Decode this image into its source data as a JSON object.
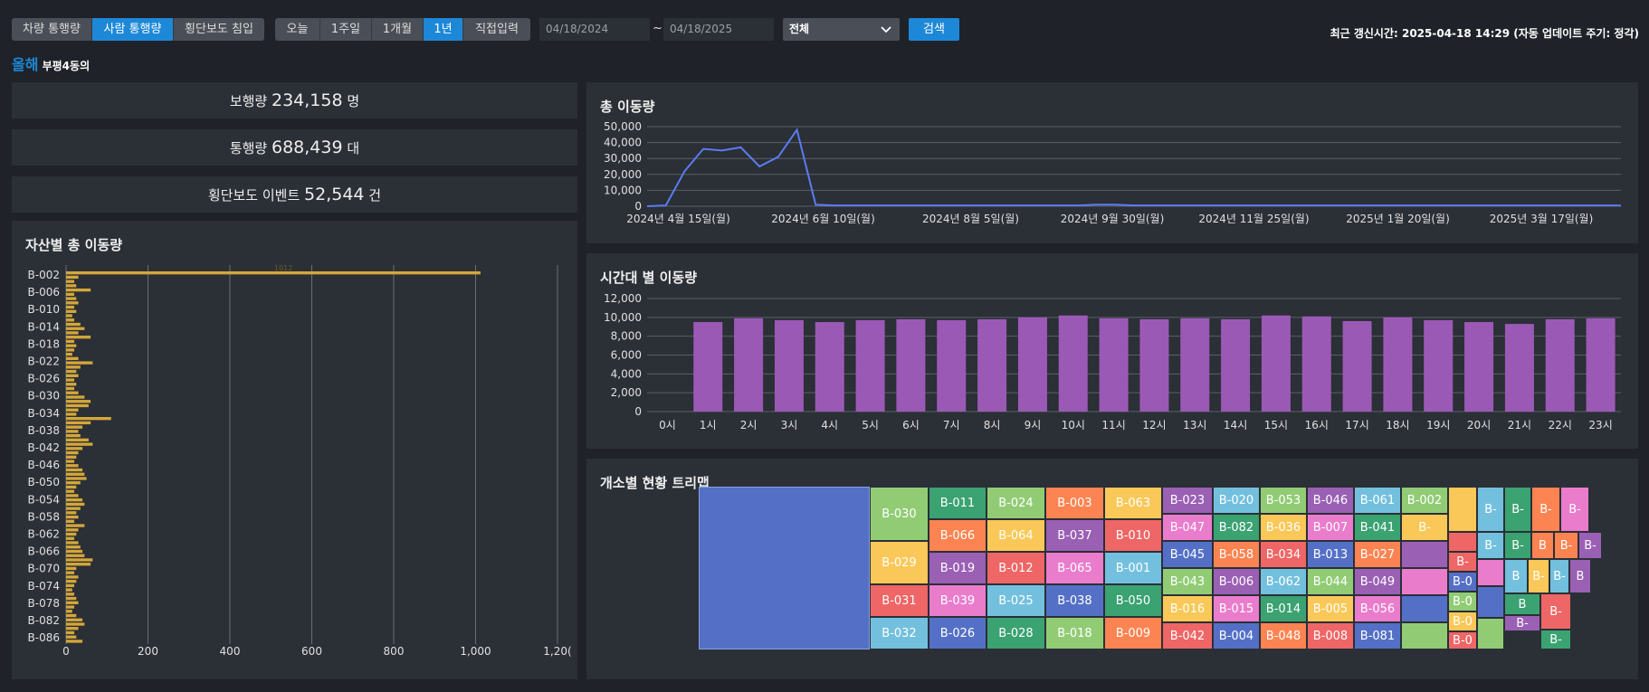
{
  "toolbar": {
    "type_tabs": [
      "차량 통행량",
      "사람 통행량",
      "횡단보도 침입"
    ],
    "active_type": 1,
    "range_tabs": [
      "오늘",
      "1주일",
      "1개월",
      "1년",
      "직접입력"
    ],
    "active_range": 3,
    "date_from": "04/18/2024",
    "date_sep": "~",
    "date_to": "04/18/2025",
    "scope_select": "전체",
    "search_label": "검색"
  },
  "update_status": "최근 갱신시간: 2025-04-18 14:29 (자동 업데이트 주기: 정각)",
  "area": {
    "prefix": "올해",
    "name": "부평4동의"
  },
  "kpis": [
    {
      "label": "보행량",
      "value": "234,158",
      "unit": "명"
    },
    {
      "label": "통행량",
      "value": "688,439",
      "unit": "대"
    },
    {
      "label": "횡단보도 이벤트",
      "value": "52,544",
      "unit": "건"
    }
  ],
  "colors": {
    "accent": "#1e88d8",
    "line": "#5b7cf0",
    "bar_purple": "#9b59b6",
    "bar_gold": "#d4a73a"
  },
  "asset_chart": {
    "title": "자산별 총 이동량",
    "y_labels": [
      "B-002",
      "B-006",
      "B-010",
      "B-014",
      "B-018",
      "B-022",
      "B-026",
      "B-030",
      "B-034",
      "B-038",
      "B-042",
      "B-046",
      "B-050",
      "B-054",
      "B-058",
      "B-062",
      "B-066",
      "B-070",
      "B-074",
      "B-078",
      "B-082",
      "B-086"
    ],
    "x_ticks": [
      "0",
      "200",
      "400",
      "600",
      "800",
      "1,000",
      "1,20("
    ],
    "top_bar_label": "1012"
  },
  "chart_data": [
    {
      "type": "line",
      "title": "총 이동량",
      "x_tick_labels": [
        "2024년 4월 15일(월)",
        "2024년 6월 10일(월)",
        "2024년 8월 5일(월)",
        "2024년 9월 30일(월)",
        "2024년 11월 25일(월)",
        "2025년 1월 20일(월)",
        "2025년 3월 17일(월)"
      ],
      "y_ticks": [
        "0",
        "10,000",
        "20,000",
        "30,000",
        "40,000",
        "50,000"
      ],
      "ylim": [
        0,
        50000
      ],
      "x_weeks": [
        0,
        1,
        2,
        3,
        4,
        5,
        6,
        7,
        8,
        9,
        10,
        11,
        12,
        13,
        14,
        15,
        16,
        17,
        18,
        19,
        20,
        21,
        22,
        23,
        24,
        25,
        26,
        27,
        28,
        29,
        30,
        31,
        32,
        33,
        34,
        35,
        36,
        37,
        38,
        39,
        40,
        41,
        42,
        43,
        44,
        45,
        46,
        47,
        48,
        49,
        50,
        51,
        52
      ],
      "values": [
        0,
        500,
        22000,
        36000,
        35000,
        37000,
        25000,
        31000,
        48000,
        1000,
        500,
        500,
        500,
        500,
        500,
        500,
        500,
        500,
        500,
        500,
        500,
        500,
        500,
        500,
        1000,
        1000,
        500,
        500,
        500,
        500,
        500,
        500,
        500,
        500,
        500,
        500,
        500,
        500,
        500,
        500,
        500,
        500,
        500,
        500,
        500,
        500,
        500,
        500,
        500,
        500,
        500,
        500,
        500
      ]
    },
    {
      "type": "bar",
      "title": "시간대 별 이동량",
      "categories": [
        "0시",
        "1시",
        "2시",
        "3시",
        "4시",
        "5시",
        "6시",
        "7시",
        "8시",
        "9시",
        "10시",
        "11시",
        "12시",
        "13시",
        "14시",
        "15시",
        "16시",
        "17시",
        "18시",
        "19시",
        "20시",
        "21시",
        "22시",
        "23시"
      ],
      "values": [
        0,
        9500,
        9900,
        9700,
        9500,
        9700,
        9800,
        9700,
        9800,
        10000,
        10200,
        9900,
        9800,
        9900,
        9800,
        10200,
        10100,
        9600,
        10000,
        9700,
        9500,
        9300,
        9800,
        9900
      ],
      "y_ticks": [
        "0",
        "2,000",
        "4,000",
        "6,000",
        "8,000",
        "10,000",
        "12,000"
      ],
      "ylim": [
        0,
        12000
      ]
    }
  ],
  "treemap": {
    "title": "개소별 현황 트리맵",
    "tiles": [
      {
        "label": "",
        "color": "#5470c6"
      },
      {
        "label": "B-030",
        "color": "#91cc75"
      },
      {
        "label": "B-029",
        "color": "#fac858"
      },
      {
        "label": "B-031",
        "color": "#ee6666"
      },
      {
        "label": "B-032",
        "color": "#73c0de"
      },
      {
        "label": "B-011",
        "color": "#3ba272"
      },
      {
        "label": "B-066",
        "color": "#fc8452"
      },
      {
        "label": "B-019",
        "color": "#9a60b4"
      },
      {
        "label": "B-039",
        "color": "#ea7ccc"
      },
      {
        "label": "B-026",
        "color": "#5470c6"
      },
      {
        "label": "B-024",
        "color": "#91cc75"
      },
      {
        "label": "B-064",
        "color": "#fac858"
      },
      {
        "label": "B-012",
        "color": "#ee6666"
      },
      {
        "label": "B-025",
        "color": "#73c0de"
      },
      {
        "label": "B-028",
        "color": "#3ba272"
      },
      {
        "label": "B-003",
        "color": "#fc8452"
      },
      {
        "label": "B-037",
        "color": "#9a60b4"
      },
      {
        "label": "B-065",
        "color": "#ea7ccc"
      },
      {
        "label": "B-038",
        "color": "#5470c6"
      },
      {
        "label": "B-018",
        "color": "#91cc75"
      },
      {
        "label": "B-063",
        "color": "#fac858"
      },
      {
        "label": "B-010",
        "color": "#ee6666"
      },
      {
        "label": "B-001",
        "color": "#73c0de"
      },
      {
        "label": "B-050",
        "color": "#3ba272"
      },
      {
        "label": "B-009",
        "color": "#fc8452"
      },
      {
        "label": "B-023",
        "color": "#9a60b4"
      },
      {
        "label": "B-047",
        "color": "#ea7ccc"
      },
      {
        "label": "B-045",
        "color": "#5470c6"
      },
      {
        "label": "B-043",
        "color": "#91cc75"
      },
      {
        "label": "B-016",
        "color": "#fac858"
      },
      {
        "label": "B-042",
        "color": "#ee6666"
      },
      {
        "label": "B-020",
        "color": "#73c0de"
      },
      {
        "label": "B-082",
        "color": "#3ba272"
      },
      {
        "label": "B-058",
        "color": "#fc8452"
      },
      {
        "label": "B-006",
        "color": "#9a60b4"
      },
      {
        "label": "B-015",
        "color": "#ea7ccc"
      },
      {
        "label": "B-004",
        "color": "#5470c6"
      },
      {
        "label": "B-053",
        "color": "#91cc75"
      },
      {
        "label": "B-036",
        "color": "#fac858"
      },
      {
        "label": "B-034",
        "color": "#ee6666"
      },
      {
        "label": "B-062",
        "color": "#73c0de"
      },
      {
        "label": "B-014",
        "color": "#3ba272"
      },
      {
        "label": "B-048",
        "color": "#fc8452"
      },
      {
        "label": "B-046",
        "color": "#9a60b4"
      },
      {
        "label": "B-007",
        "color": "#ea7ccc"
      },
      {
        "label": "B-013",
        "color": "#5470c6"
      },
      {
        "label": "B-044",
        "color": "#91cc75"
      },
      {
        "label": "B-005",
        "color": "#fac858"
      },
      {
        "label": "B-008",
        "color": "#ee6666"
      },
      {
        "label": "B-061",
        "color": "#73c0de"
      },
      {
        "label": "B-041",
        "color": "#3ba272"
      },
      {
        "label": "B-027",
        "color": "#fc8452"
      },
      {
        "label": "B-049",
        "color": "#9a60b4"
      },
      {
        "label": "B-056",
        "color": "#ea7ccc"
      },
      {
        "label": "B-081",
        "color": "#5470c6"
      },
      {
        "label": "B-002",
        "color": "#91cc75"
      },
      {
        "label": "B-",
        "color": "#fac858"
      },
      {
        "label": "",
        "color": "#9a60b4"
      },
      {
        "label": "",
        "color": "#ea7ccc"
      },
      {
        "label": "",
        "color": "#5470c6"
      },
      {
        "label": "",
        "color": "#91cc75"
      },
      {
        "label": "",
        "color": "#fac858"
      },
      {
        "label": "",
        "color": "#ee6666"
      },
      {
        "label": "B-",
        "color": "#ee6666"
      },
      {
        "label": "B-0",
        "color": "#5470c6"
      },
      {
        "label": "B-0",
        "color": "#91cc75"
      },
      {
        "label": "B-0",
        "color": "#fac858"
      },
      {
        "label": "B-0",
        "color": "#ee6666"
      },
      {
        "label": "B-",
        "color": "#73c0de"
      },
      {
        "label": "B-",
        "color": "#73c0de"
      },
      {
        "label": "",
        "color": "#ea7ccc"
      },
      {
        "label": "",
        "color": "#5470c6"
      },
      {
        "label": "",
        "color": "#91cc75"
      },
      {
        "label": "B-",
        "color": "#3ba272"
      },
      {
        "label": "B-",
        "color": "#3ba272"
      },
      {
        "label": "B",
        "color": "#73c0de"
      },
      {
        "label": "B",
        "color": "#3ba272"
      },
      {
        "label": "B-",
        "color": "#9a60b4"
      },
      {
        "label": "B-",
        "color": "#fc8452"
      },
      {
        "label": "B",
        "color": "#fc8452"
      },
      {
        "label": "B-",
        "color": "#fac858"
      },
      {
        "label": "B-",
        "color": "#73c0de"
      },
      {
        "label": "B-",
        "color": "#fc8452"
      },
      {
        "label": "B-",
        "color": "#9a60b4"
      },
      {
        "label": "B",
        "color": "#9a60b4"
      },
      {
        "label": "B-",
        "color": "#ee6666"
      },
      {
        "label": "B-",
        "color": "#3ba272"
      },
      {
        "label": "B-",
        "color": "#ea7ccc"
      }
    ]
  }
}
